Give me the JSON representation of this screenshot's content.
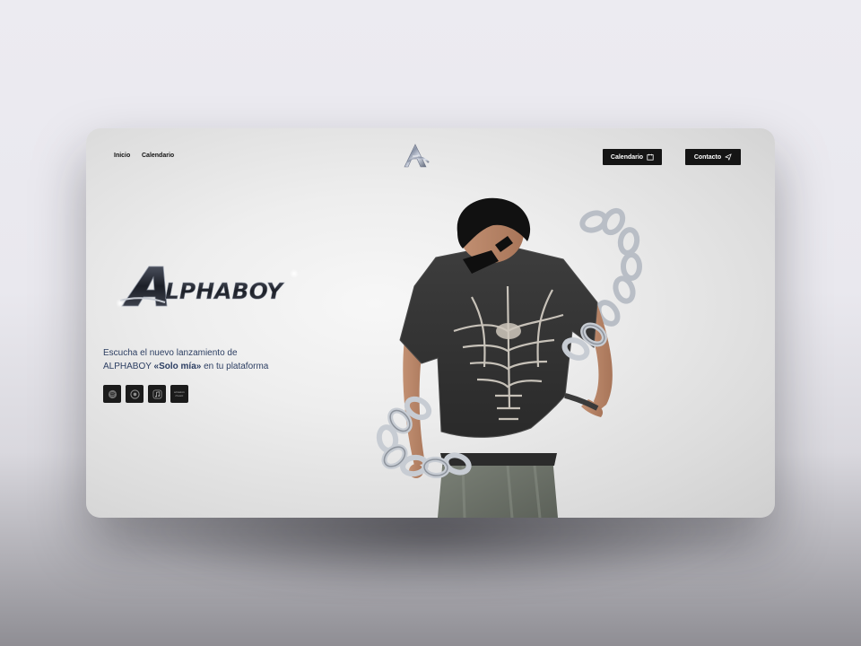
{
  "nav": {
    "home_label": "Inicio",
    "calendar_label": "Calendario"
  },
  "actions": {
    "calendar_button": "Calendario",
    "contact_button": "Contacto"
  },
  "brand": {
    "wordmark": "ALPHABOY"
  },
  "tagline": {
    "line1": "Escucha el nuevo lanzamiento de",
    "artist": "ALPHABOY",
    "release": "«Solo mía»",
    "line2_suffix": " en tu plataforma"
  },
  "platforms": [
    {
      "icon": "spotify-icon"
    },
    {
      "icon": "disc-icon"
    },
    {
      "icon": "apple-music-icon"
    },
    {
      "icon": "amazon-music-icon",
      "label_top": "amazon",
      "label_bottom": "music"
    }
  ],
  "colors": {
    "button_bg": "#151515",
    "tagline_text": "#2c3e62",
    "card_bg": "#eeeeee"
  }
}
